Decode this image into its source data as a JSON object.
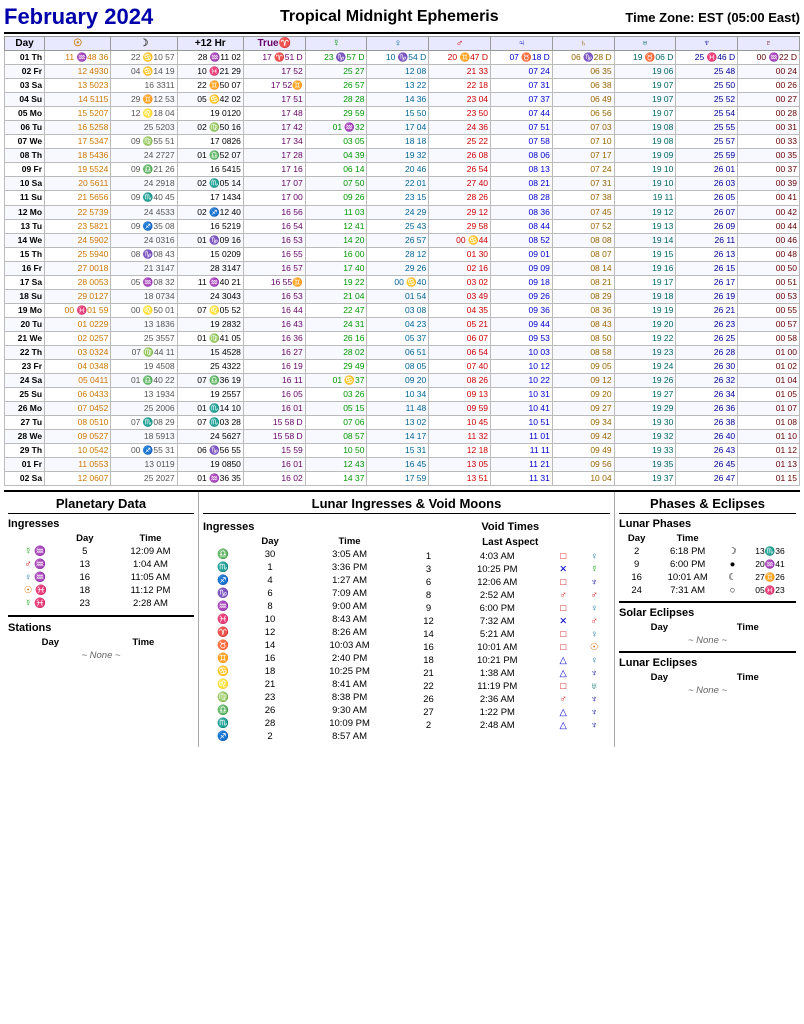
{
  "header": {
    "title": "February 2024",
    "subtitle": "Tropical Midnight Ephemeris",
    "timezone": "Time Zone: EST  (05:00 East)"
  },
  "columns": [
    "Day",
    "☉",
    "☽",
    "+12 Hr",
    "True♈",
    "☿",
    "♀",
    "♂",
    "♃",
    "♄",
    "♅",
    "♆",
    "♇"
  ],
  "rows": [
    [
      "01 Th",
      "11 ♒48 36",
      "22 ♋10 57",
      "28 ♒11 02",
      "17 ♈51 D",
      "23 ♑57 D",
      "10 ♑54 D",
      "20 ♊47 D",
      "07 ♉18 D",
      "06 ♑28 D",
      "19 ♉06 D",
      "25 ♓46 D",
      "00 ♒22 D"
    ],
    [
      "02 Fr",
      "12 4930",
      "04 ♋14 19",
      "10 ♓21 29",
      "17 52",
      "25 27",
      "12 08",
      "21 33",
      "07 24",
      "06 35",
      "19 06",
      "25 48",
      "00 24"
    ],
    [
      "03 Sa",
      "13 5023",
      "16 3311",
      "22 ♊50 07",
      "17 52♊",
      "26 57",
      "13 22",
      "22 18",
      "07 31",
      "06 38",
      "19 07",
      "25 50",
      "00 26"
    ],
    [
      "04 Su",
      "14 5115",
      "29 ♊12 53",
      "05 ♋42 02",
      "17 51",
      "28 28",
      "14 36",
      "23 04",
      "07 37",
      "06 49",
      "19 07",
      "25 52",
      "00 27"
    ],
    [
      "05 Mo",
      "15 5207",
      "12 ♌18 04",
      "19 0120",
      "17 48",
      "29 59",
      "15 50",
      "23 50",
      "07 44",
      "06 56",
      "19 07",
      "25 54",
      "00 28"
    ],
    [
      "06 Tu",
      "16 5258",
      "25 5203",
      "02 ♍50 16",
      "17 42",
      "01 ♒32",
      "17 04",
      "24 36",
      "07 51",
      "07 03",
      "19 08",
      "25 55",
      "00 31"
    ],
    [
      "07 We",
      "17 5347",
      "09 ♍55 51",
      "17 0826",
      "17 34",
      "03 05",
      "18 18",
      "25 22",
      "07 58",
      "07 10",
      "19 08",
      "25 57",
      "00 33"
    ],
    [
      "08 Th",
      "18 5436",
      "24 2727",
      "01 ♎52 07",
      "17 28",
      "04 39",
      "19 32",
      "26 08",
      "08 06",
      "07 17",
      "19 09",
      "25 59",
      "00 35"
    ],
    [
      "09 Fr",
      "19 5524",
      "09 ♎21 26",
      "16 5415",
      "17 16",
      "06 14",
      "20 46",
      "26 54",
      "08 13",
      "07 24",
      "19 10",
      "26 01",
      "00 37"
    ],
    [
      "10 Sa",
      "20 5611",
      "24 2918",
      "02 ♏05 14",
      "17 07",
      "07 50",
      "22 01",
      "27 40",
      "08 21",
      "07 31",
      "19 10",
      "26 03",
      "00 39"
    ],
    [
      "11 Su",
      "21 5656",
      "09 ♏40 45",
      "17 1434",
      "17 00",
      "09 26",
      "23 15",
      "28 26",
      "08 28",
      "07 38",
      "19 11",
      "26 05",
      "00 41"
    ],
    [
      "12 Mo",
      "22 5739",
      "24 4533",
      "02 ♐12 40",
      "16 56",
      "11 03",
      "24 29",
      "29 12",
      "08 36",
      "07 45",
      "19 12",
      "26 07",
      "00 42"
    ],
    [
      "13 Tu",
      "23 5821",
      "09 ♐35 08",
      "16 5219",
      "16 54",
      "12 41",
      "25 43",
      "29 58",
      "08 44",
      "07 52",
      "19 13",
      "26 09",
      "00 44"
    ],
    [
      "14 We",
      "24 5902",
      "24 0316",
      "01 ♑09 16",
      "16 53",
      "14 20",
      "26 57",
      "00 ♋44",
      "08 52",
      "08 08",
      "19 14",
      "26 11",
      "00 46"
    ],
    [
      "15 Th",
      "25 5940",
      "08 ♑08 43",
      "15 0209",
      "16 55",
      "16 00",
      "28 12",
      "01 30",
      "09 01",
      "08 07",
      "19 15",
      "26 13",
      "00 48"
    ],
    [
      "16 Fr",
      "27 0018",
      "21 3147",
      "28 3147",
      "16 57",
      "17 40",
      "29 26",
      "02 16",
      "09 09",
      "08 14",
      "19 16",
      "26 15",
      "00 50"
    ],
    [
      "17 Sa",
      "28 0053",
      "05 ♒08 32",
      "11 ♒40 21",
      "16 55♊",
      "19 22",
      "00 ♋40",
      "03 02",
      "09 18",
      "08 21",
      "19 17",
      "26 17",
      "00 51"
    ],
    [
      "18 Su",
      "29 0127",
      "18 0734",
      "24 3043",
      "16 53",
      "21 04",
      "01 54",
      "03 49",
      "09 26",
      "08 29",
      "19 18",
      "26 19",
      "00 53"
    ],
    [
      "19 Mo",
      "00 ♓01 59",
      "00 ♌50 01",
      "07 ♌05 52",
      "16 44",
      "22 47",
      "03 08",
      "04 35",
      "09 36",
      "08 36",
      "19 19",
      "26 21",
      "00 55"
    ],
    [
      "20 Tu",
      "01 0229",
      "13 1836",
      "19 2832",
      "16 43",
      "24 31",
      "04 23",
      "05 21",
      "09 44",
      "08 43",
      "19 20",
      "26 23",
      "00 57"
    ],
    [
      "21 We",
      "02 0257",
      "25 3557",
      "01 ♍41 05",
      "16 36",
      "26 16",
      "05 37",
      "06 07",
      "09 53",
      "08 50",
      "19 22",
      "26 25",
      "00 58"
    ],
    [
      "22 Th",
      "03 0324",
      "07 ♍44 11",
      "15 4528",
      "16 27",
      "28 02",
      "06 51",
      "06 54",
      "10 03",
      "08 58",
      "19 23",
      "26 28",
      "01 00"
    ],
    [
      "23 Fr",
      "04 0348",
      "19 4508",
      "25 4322",
      "16 19",
      "29 49",
      "08 05",
      "07 40",
      "10 12",
      "09 05",
      "19 24",
      "26 30",
      "01 02"
    ],
    [
      "24 Sa",
      "05 0411",
      "01 ♎40 22",
      "07 ♎36 19",
      "16 11",
      "01 ♋37",
      "09 20",
      "08 26",
      "10 22",
      "09 12",
      "19 26",
      "26 32",
      "01 04"
    ],
    [
      "25 Su",
      "06 0433",
      "13 1934",
      "19 2557",
      "16 05",
      "03 26",
      "10 34",
      "09 13",
      "10 31",
      "09 20",
      "19 27",
      "26 34",
      "01 05"
    ],
    [
      "26 Mo",
      "07 0452",
      "25 2006",
      "01 ♏14 10",
      "16 01",
      "05 15",
      "11 48",
      "09 59",
      "10 41",
      "09 27",
      "19 29",
      "26 36",
      "01 07"
    ],
    [
      "27 Tu",
      "08 0510",
      "07 ♏08 29",
      "07 ♏03 28",
      "15 58 D",
      "07 06",
      "13 02",
      "10 45",
      "10 51",
      "09 34",
      "19 30",
      "26 38",
      "01 08"
    ],
    [
      "28 We",
      "09 0527",
      "18 5913",
      "24 5627",
      "15 58 D",
      "08 57",
      "14 17",
      "11 32",
      "11 01",
      "09 42",
      "19 32",
      "26 40",
      "01 10"
    ],
    [
      "29 Th",
      "10 0542",
      "00 ♐55 31",
      "06 ♑56 55",
      "15 59",
      "10 50",
      "15 31",
      "12 18",
      "11 11",
      "09 49",
      "19 33",
      "26 43",
      "01 12"
    ],
    [
      "01 Fr",
      "11 0553",
      "13 0119",
      "19 0850",
      "16 01",
      "12 43",
      "16 45",
      "13 05",
      "11 21",
      "09 56",
      "19 35",
      "26 45",
      "01 13"
    ],
    [
      "02 Sa",
      "12 0607",
      "25 2027",
      "01 ♒36 35",
      "16 02",
      "14 37",
      "17 59",
      "13 51",
      "11 31",
      "10 04",
      "19 37",
      "26 47",
      "01 15"
    ]
  ],
  "planetary_data": {
    "title": "Planetary Data",
    "ingresses_title": "Ingresses",
    "col_headers": [
      "",
      "Day",
      "Time"
    ],
    "ingresses": [
      {
        "sym": "☿",
        "sign": "♒",
        "color": "green",
        "day": "5",
        "time": "12:09 AM"
      },
      {
        "sym": "♂",
        "sign": "♒",
        "color": "red",
        "day": "13",
        "time": "1:04 AM"
      },
      {
        "sym": "♀",
        "sign": "♒",
        "color": "blue",
        "day": "16",
        "time": "11:05 AM"
      },
      {
        "sym": "☉",
        "sign": "♓",
        "color": "orange",
        "day": "18",
        "time": "11:12 PM"
      },
      {
        "sym": "☿",
        "sign": "♓",
        "color": "green",
        "day": "23",
        "time": "2:28 AM"
      }
    ],
    "stations_title": "Stations",
    "stations_col_headers": [
      "Day",
      "Time"
    ],
    "stations_none": "~ None ~"
  },
  "lunar_ingresses": {
    "title": "Lunar Ingresses & Void Moons",
    "ingresses_title": "Ingresses",
    "col_headers": [
      "",
      "Day",
      "Time"
    ],
    "ingresses": [
      {
        "sign": "♎",
        "day": "30",
        "time": "3:05 AM"
      },
      {
        "sign": "♏",
        "day": "1",
        "time": "3:36 PM"
      },
      {
        "sign": "♐",
        "day": "4",
        "time": "1:27 AM"
      },
      {
        "sign": "♑",
        "day": "6",
        "time": "7:09 AM"
      },
      {
        "sign": "♒",
        "day": "8",
        "time": "9:00 AM"
      },
      {
        "sign": "♓",
        "day": "10",
        "time": "8:43 AM"
      },
      {
        "sign": "♈",
        "day": "12",
        "time": "8:26 AM"
      },
      {
        "sign": "♉",
        "day": "14",
        "time": "10:03 AM"
      },
      {
        "sign": "♊",
        "day": "16",
        "time": "2:40 PM"
      },
      {
        "sign": "♋",
        "day": "18",
        "time": "10:25 PM"
      },
      {
        "sign": "♌",
        "day": "21",
        "time": "8:41 AM"
      },
      {
        "sign": "♍",
        "day": "23",
        "time": "8:38 PM"
      },
      {
        "sign": "♎",
        "day": "26",
        "time": "9:30 AM"
      },
      {
        "sign": "♏",
        "day": "28",
        "time": "10:09 PM"
      },
      {
        "sign": "♐",
        "day": "2",
        "time": "8:57 AM"
      }
    ],
    "void_title": "Void Times",
    "last_aspect": "Last Aspect",
    "void_times": [
      {
        "day": "1",
        "time": "4:03 AM",
        "aspect": "□",
        "asp_color": "red",
        "planet": "♀",
        "pl_color": "blue"
      },
      {
        "day": "3",
        "time": "10:25 PM",
        "aspect": "✕",
        "asp_color": "blue",
        "planet": "☿",
        "pl_color": "green"
      },
      {
        "day": "6",
        "time": "12:06 AM",
        "aspect": "□",
        "asp_color": "red",
        "planet": "♆",
        "pl_color": "darkblue"
      },
      {
        "day": "8",
        "time": "2:52 AM",
        "aspect": "♂",
        "asp_color": "red",
        "planet": "♂",
        "pl_color": "red"
      },
      {
        "day": "9",
        "time": "6:00 PM",
        "aspect": "□",
        "asp_color": "red",
        "planet": "♀",
        "pl_color": "blue"
      },
      {
        "day": "12",
        "time": "7:32 AM",
        "aspect": "✕",
        "asp_color": "blue",
        "planet": "♂",
        "pl_color": "red"
      },
      {
        "day": "14",
        "time": "5:21 AM",
        "aspect": "□",
        "asp_color": "red",
        "planet": "♀",
        "pl_color": "blue"
      },
      {
        "day": "16",
        "time": "10:01 AM",
        "aspect": "□",
        "asp_color": "red",
        "planet": "☉",
        "pl_color": "orange"
      },
      {
        "day": "18",
        "time": "10:21 PM",
        "aspect": "△",
        "asp_color": "blue",
        "planet": "♀",
        "pl_color": "blue"
      },
      {
        "day": "21",
        "time": "1:38 AM",
        "aspect": "△",
        "asp_color": "blue",
        "planet": "♆",
        "pl_color": "darkblue"
      },
      {
        "day": "22",
        "time": "11:19 PM",
        "aspect": "□",
        "asp_color": "red",
        "planet": "♅",
        "pl_color": "teal"
      },
      {
        "day": "26",
        "time": "2:36 AM",
        "aspect": "♂",
        "asp_color": "red",
        "planet": "♆",
        "pl_color": "darkblue"
      },
      {
        "day": "27",
        "time": "1:22 PM",
        "aspect": "△",
        "asp_color": "blue",
        "planet": "♆",
        "pl_color": "darkblue"
      },
      {
        "day": "2",
        "time": "2:48 AM",
        "aspect": "△",
        "asp_color": "blue",
        "planet": "♆",
        "pl_color": "darkblue"
      }
    ]
  },
  "phases_eclipses": {
    "title": "Phases & Eclipses",
    "lunar_phases_title": "Lunar Phases",
    "col_headers": [
      "Day",
      "Time"
    ],
    "phases": [
      {
        "day": "2",
        "time": "6:18 PM",
        "symbol": "☽",
        "sym_color": "black",
        "detail": "13♏36"
      },
      {
        "day": "9",
        "time": "6:00 PM",
        "symbol": "●",
        "sym_color": "black",
        "detail": "20♒41"
      },
      {
        "day": "16",
        "time": "10:01 AM",
        "symbol": "☾",
        "sym_color": "black",
        "detail": "27♊26"
      },
      {
        "day": "24",
        "time": "7:31 AM",
        "symbol": "○",
        "sym_color": "black",
        "detail": "05♓23"
      }
    ],
    "solar_eclipses_title": "Solar Eclipses",
    "solar_col_headers": [
      "Day",
      "Time"
    ],
    "solar_none": "~ None ~",
    "lunar_eclipses_title": "Lunar Eclipses",
    "lunar_col_headers": [
      "Day",
      "Time"
    ],
    "lunar_none": "~ None ~"
  }
}
